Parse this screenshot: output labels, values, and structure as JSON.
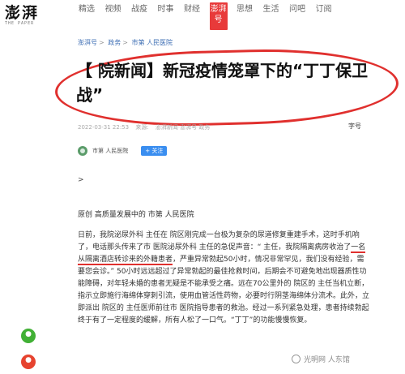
{
  "header": {
    "logo_text": "澎湃",
    "logo_sub": "THE PAPER",
    "nav": [
      "精选",
      "视频",
      "战疫",
      "时事",
      "财经",
      "澎湃号",
      "思想",
      "生活",
      "问吧",
      "订阅"
    ],
    "active_index": 5
  },
  "breadcrumb": {
    "items": [
      "澎湃号",
      "政务",
      "市第 人民医院"
    ]
  },
  "article": {
    "title": "【 院新闻】新冠疫情笼罩下的“丁丁保卫战”",
    "date": "2022-03-31 22:53",
    "source_label": "来源:",
    "channel": "澎湃新闻·澎湃号·政务",
    "font_size_label": "字号",
    "author": "市第 人民医院",
    "follow_label": "+ 关注",
    "arrow": ">",
    "intro": "原创 高质量发展中的 市第 人民医院",
    "p1_before": "日前，我院泌尿外科 主任在 院区刚完成一台极为复杂的尿道修复重建手术，这时手机响了，电话那头传来了市 医院泌尿外科 主任的急促声音：“ 主任，我院隔离病房收治了",
    "p1_highlight": "一名从隔离酒店转诊来的外籍患者",
    "p1_after": "，严重异常勃起50小时，情况非常罕见，我们没有经验，需要您会诊。” 50小时远远超过了异常勃起的最佳抢救时间，后期会不可避免地出现器质性功能障碍，对年轻未婚的患者无疑是不能承受之痛。远在70公里外的 院区的 主任当机立断，指示立即施行海绵体穿刺引流，使用血管活性药物，必要时行阴茎海绵体分流术。此外，立即派出 院区的 主任医师前往市 医院指导患者的救治。经过一系列紧急处理，患者持续勃起终于有了一定程度的缓解，所有人松了一口气。“丁丁”的功能慢慢恢复。"
  },
  "watermark": "光明网 人东馆",
  "side_icons": [
    "wechat-icon",
    "weibo-icon"
  ],
  "colors": {
    "accent": "#e83a3a",
    "link": "#3b6cb3",
    "ring": "#e0302e",
    "follow": "#3a8ef0"
  }
}
